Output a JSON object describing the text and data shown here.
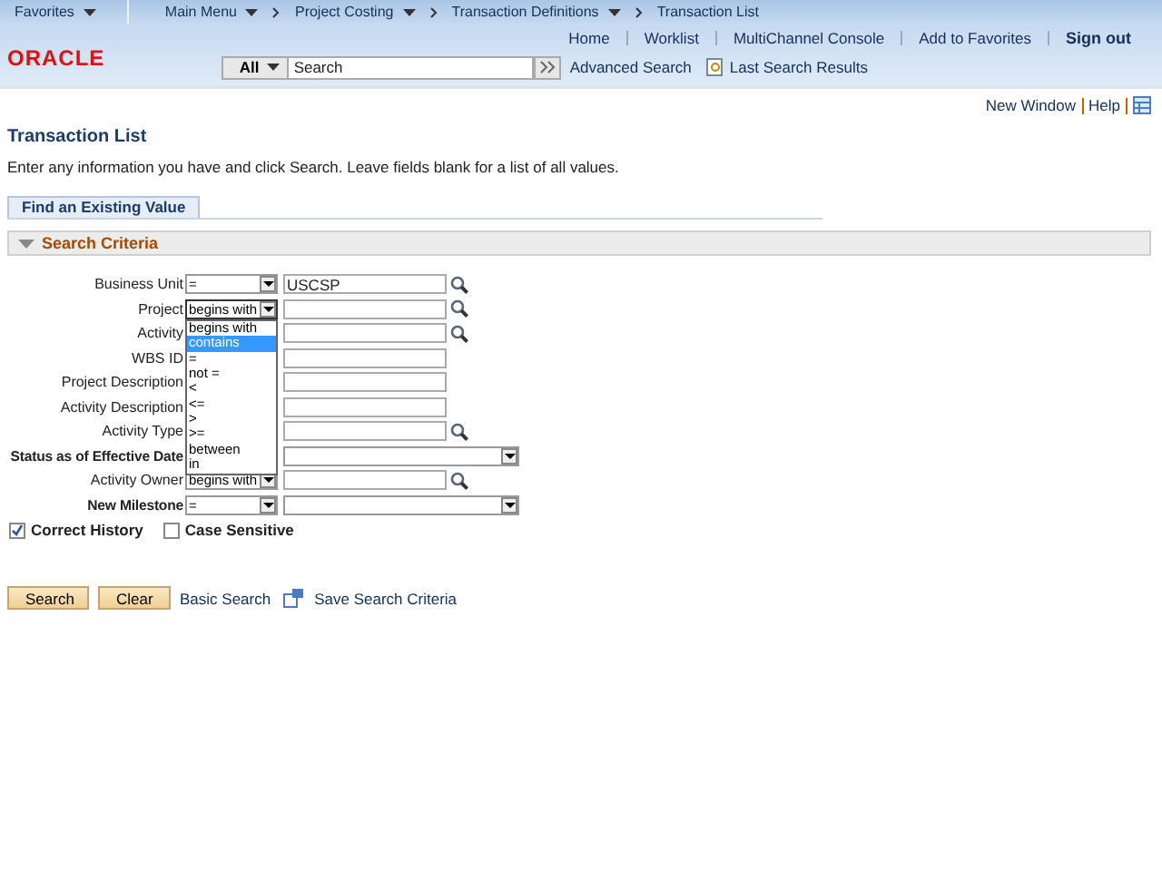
{
  "nav": {
    "breadcrumbs": [
      {
        "label": "Favorites",
        "caret": true
      },
      {
        "label": "Main Menu",
        "caret": true
      },
      {
        "label": "Project Costing",
        "caret": true
      },
      {
        "label": "Transaction Definitions",
        "caret": true
      },
      {
        "label": "Transaction List",
        "caret": false
      }
    ]
  },
  "header": {
    "logo": "ORACLE",
    "links": [
      "Home",
      "Worklist",
      "MultiChannel Console",
      "Add to Favorites"
    ],
    "signout": "Sign out",
    "search_scope": "All",
    "search_placeholder": "Search",
    "advanced_search": "Advanced Search",
    "last_results": "Last Search Results"
  },
  "toolbar": {
    "links": [
      "New Window",
      "Help"
    ]
  },
  "page": {
    "title": "Transaction List",
    "instructions": "Enter any information you have and click Search. Leave fields blank for a list of all values.",
    "tab": "Find an Existing Value",
    "section": "Search Criteria"
  },
  "criteria": [
    {
      "label": "Business Unit",
      "bold": false,
      "operator": "=",
      "kind": "text",
      "value": "USCSP",
      "lookup": true
    },
    {
      "label": "Project",
      "bold": false,
      "operator": "begins with",
      "kind": "text",
      "lookup": true,
      "open": true
    },
    {
      "label": "Activity",
      "bold": false,
      "kind": "text",
      "lookup": true
    },
    {
      "label": "WBS ID",
      "bold": false,
      "kind": "text",
      "lookup": false
    },
    {
      "label": "Project Description",
      "bold": false,
      "kind": "text",
      "lookup": false
    },
    {
      "label": "Activity Description",
      "bold": false,
      "kind": "text",
      "lookup": false
    },
    {
      "label": "Activity Type",
      "bold": false,
      "kind": "text",
      "lookup": true
    },
    {
      "label": "Status as of Effective Date",
      "bold": true,
      "kind": "select",
      "lookup": false
    },
    {
      "label": "Activity Owner",
      "bold": false,
      "operator": "begins with",
      "kind": "text",
      "lookup": true
    },
    {
      "label": "New Milestone",
      "bold": true,
      "operator": "=",
      "kind": "select",
      "lookup": false
    }
  ],
  "dropdown_options": [
    {
      "label": "begins with",
      "selected": false
    },
    {
      "label": "contains",
      "selected": true
    },
    {
      "label": "=",
      "selected": false
    },
    {
      "label": "not =",
      "selected": false
    },
    {
      "label": "<",
      "selected": false
    },
    {
      "label": "<=",
      "selected": false
    },
    {
      "label": ">",
      "selected": false
    },
    {
      "label": ">=",
      "selected": false
    },
    {
      "label": "between",
      "selected": false
    },
    {
      "label": "in",
      "selected": false
    }
  ],
  "checkboxes": [
    {
      "label": "Correct History",
      "checked": true
    },
    {
      "label": "Case Sensitive",
      "checked": false
    }
  ],
  "buttons": [
    "Search",
    "Clear"
  ],
  "basic_search": "Basic Search",
  "save_criteria": "Save Search Criteria"
}
